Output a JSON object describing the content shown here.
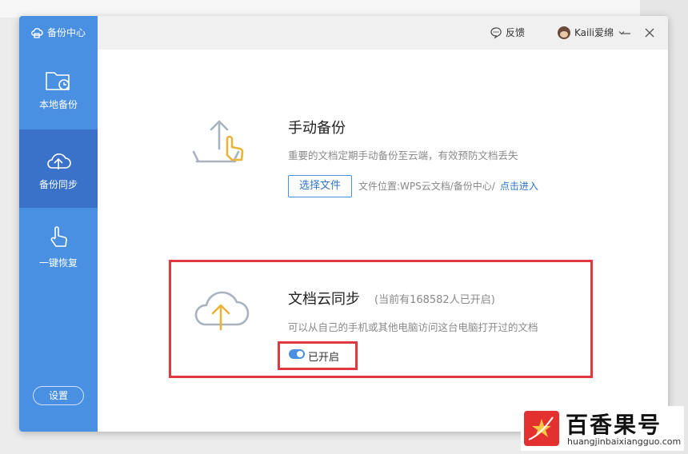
{
  "app": {
    "title": "备份中心"
  },
  "sidebar": {
    "items": [
      {
        "label": "本地备份",
        "icon": "folder-clock-icon"
      },
      {
        "label": "备份同步",
        "icon": "cloud-upload-icon"
      },
      {
        "label": "一键恢复",
        "icon": "hand-pointer-icon"
      }
    ],
    "settings_label": "设置"
  },
  "titlebar": {
    "feedback_label": "反馈",
    "user_name": "Kaili爱绵"
  },
  "manual_backup": {
    "title": "手动备份",
    "description": "重要的文档定期手动备份至云端，有效预防文档丢失",
    "button_label": "选择文件",
    "location_text": "文件位置:WPS云文档/备份中心/",
    "location_link": "点击进入"
  },
  "cloud_sync": {
    "title": "文档云同步",
    "subtitle": "(当前有168582人已开启)",
    "description": "可以从自己的手机或其他电脑访问这台电脑打开过的文档",
    "toggle_label": "已开启",
    "toggle_on": true
  },
  "watermark": {
    "title": "百香果号",
    "url": "huangjinbaixiangguo.com"
  },
  "colors": {
    "accent": "#4a90e2",
    "sidebar_active": "#3a72c9",
    "highlight": "#e0383e",
    "icon_gold": "#e8b53a"
  }
}
